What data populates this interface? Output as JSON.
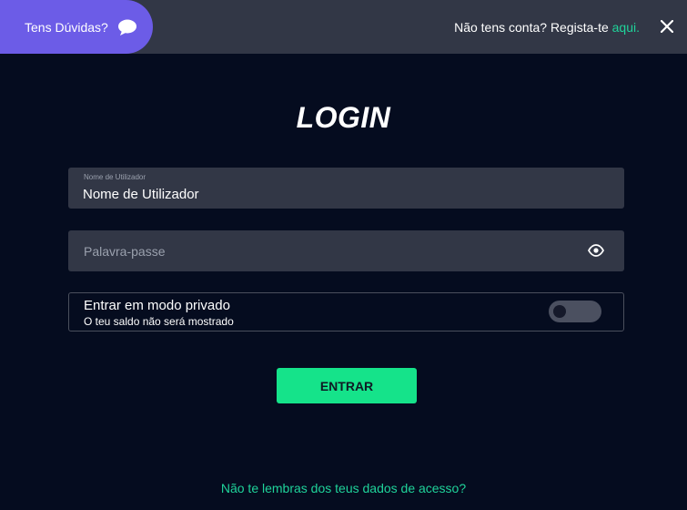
{
  "header": {
    "help_label": "Tens Dúvidas?",
    "help_icon": "chat-bubble-icon",
    "signup_prompt": "Não tens conta? Regista-te ",
    "signup_link": "aqui.",
    "close_icon": "close-icon"
  },
  "login": {
    "title": "LOGIN",
    "username": {
      "label": "Nome de Utilizador",
      "value": "Nome de Utilizador"
    },
    "password": {
      "placeholder": "Palavra-passe",
      "toggle_icon": "eye-icon"
    },
    "private_mode": {
      "title": "Entrar em modo privado",
      "subtitle": "O teu saldo não será mostrado",
      "enabled": false
    },
    "submit_label": "ENTRAR",
    "forgot_link": "Não te lembras dos teus dados de acesso?"
  },
  "colors": {
    "background": "#050c1f",
    "topbar": "#323746",
    "help_pill": "#6c5ce7",
    "accent": "#1fd39a",
    "button": "#15e38a",
    "field": "#323746"
  }
}
